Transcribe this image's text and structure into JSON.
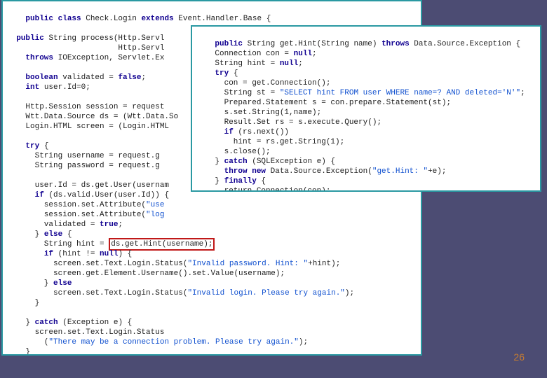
{
  "page_number": "26",
  "main_code": {
    "raw": "public class Check.Login extends Event.Handler.Base {\n\n  public String process(Http.Servl\n                        Http.Servl\n    throws IOException, Servlet.Ex\n\n    boolean validated = false;\n    int user.Id=0;\n\n    Http.Session session = request\n    Wtt.Data.Source ds = (Wtt.Data.So\n    Login.HTML screen = (Login.HTML\n\n    try {\n      String username = request.g\n      String password = request.g\n\n      user.Id = ds.get.User(usernam\n      if (ds.valid.User(user.Id)) {\n        session.set.Attribute(\"use\n        session.set.Attribute(\"log\n        validated = true;\n      } else {\n        String hint = ds.get.Hint(username);\n        if (hint != null) {\n          screen.set.Text.Login.Status(\"Invalid password. Hint: \"+hint);\n          screen.get.Element.Username().set.Value(username);\n        } else\n          screen.set.Text.Login.Status(\"Invalid login. Please try again.\");\n      }\n\n    } catch (Exception e) {\n      screen.set.Text.Login.Status\n        (\"There may be a connection problem. Please try again.\");\n    }"
  },
  "popup_code": {
    "raw": "public String get.Hint(String name) throws Data.Source.Exception {\n    Connection con = null;\n    String hint = null;\n    try {\n      con = get.Connection();\n      String st = \"SELECT hint FROM user WHERE name=? AND deleted='N'\";\n      Prepared.Statement s = con.prepare.Statement(st);\n      s.set.String(1,name);\n      Result.Set rs = s.execute.Query();\n      if (rs.next())\n        hint = rs.get.String(1);\n      s.close();\n    } catch (SQLException e) {\n      throw new Data.Source.Exception(\"get.Hint: \"+e);\n    } finally {\n      return.Connection(con);\n    }\n    return hint;\n  }"
  },
  "highlight_text": "ds.get.Hint(username);"
}
